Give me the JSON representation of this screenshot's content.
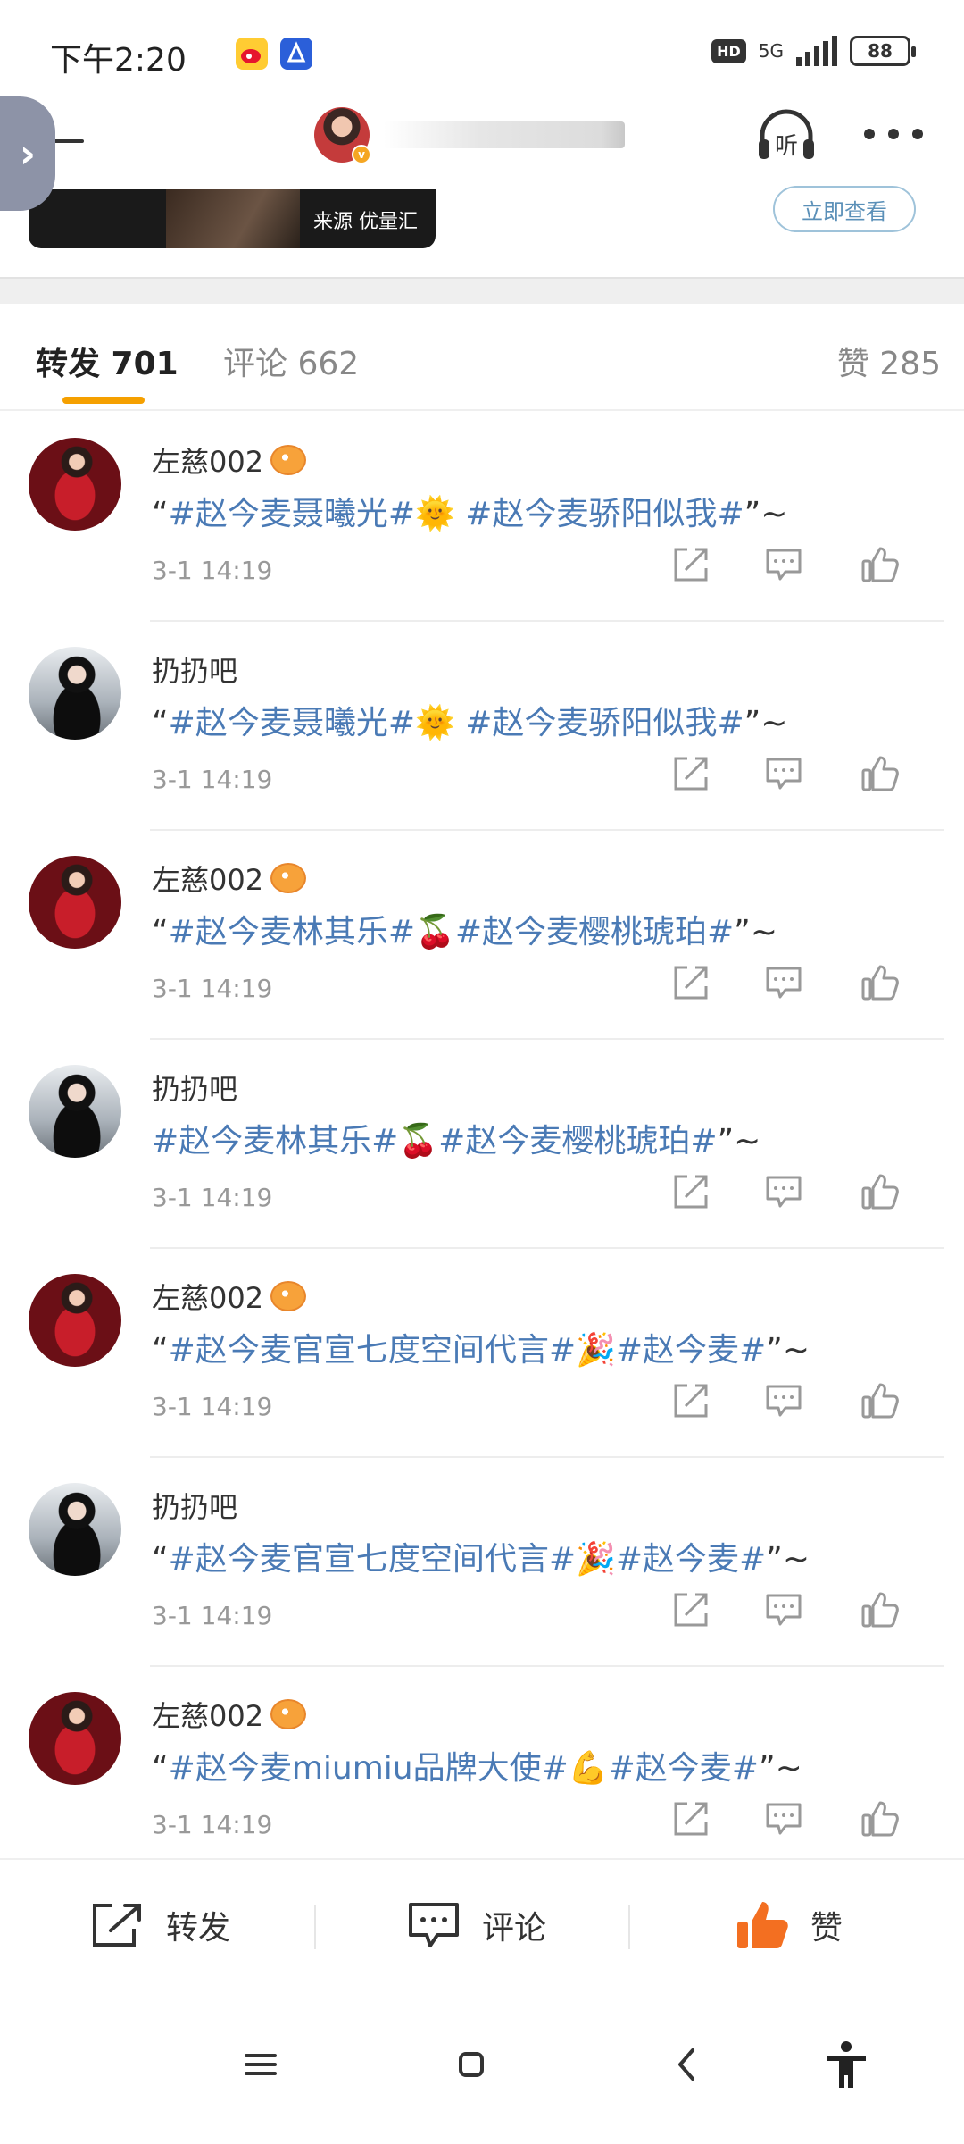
{
  "status_bar": {
    "time": "下午2:20",
    "network": "5G",
    "hd": "HD",
    "battery": "88"
  },
  "header": {
    "listen_label": "听"
  },
  "ad": {
    "source": "来源 优量汇",
    "cta": "立即查看"
  },
  "tabs": {
    "repost": "转发 701",
    "comment": "评论 662",
    "like": "赞 285"
  },
  "items": [
    {
      "user": "左慈002",
      "badge": true,
      "avatar": "red",
      "pre": "“",
      "t1": "#赵今麦聂曦光#",
      "emoji": "🌞",
      "sep": " ",
      "t2": "#赵今麦骄阳似我#",
      "post": "”~",
      "time": "3-1 14:19"
    },
    {
      "user": "扔扔吧",
      "badge": false,
      "avatar": "dark",
      "pre": "“",
      "t1": "#赵今麦聂曦光#",
      "emoji": "🌞",
      "sep": " ",
      "t2": "#赵今麦骄阳似我#",
      "post": "”~",
      "time": "3-1 14:19"
    },
    {
      "user": "左慈002",
      "badge": true,
      "avatar": "red",
      "pre": "“",
      "t1": "#赵今麦林其乐#",
      "emoji": "🍒",
      "sep": "",
      "t2": "#赵今麦樱桃琥珀#",
      "post": "”~",
      "time": "3-1 14:19"
    },
    {
      "user": "扔扔吧",
      "badge": false,
      "avatar": "dark",
      "pre": "",
      "t1": "#赵今麦林其乐#",
      "emoji": "🍒",
      "sep": "",
      "t2": "#赵今麦樱桃琥珀#",
      "post": "”~",
      "time": "3-1 14:19"
    },
    {
      "user": "左慈002",
      "badge": true,
      "avatar": "red",
      "pre": "“",
      "t1": "#赵今麦官宣七度空间代言#",
      "emoji": "🎉",
      "sep": "",
      "t2": "#赵今麦#",
      "post": "”~",
      "time": "3-1 14:19"
    },
    {
      "user": "扔扔吧",
      "badge": false,
      "avatar": "dark",
      "pre": "“",
      "t1": "#赵今麦官宣七度空间代言#",
      "emoji": "🎉",
      "sep": "",
      "t2": "#赵今麦#",
      "post": "”~",
      "time": "3-1 14:19"
    },
    {
      "user": "左慈002",
      "badge": true,
      "avatar": "red",
      "pre": "“",
      "t1": "#赵今麦miumiu品牌大使#",
      "emoji": "💪",
      "sep": "",
      "t2": "#赵今麦#",
      "post": "”~",
      "time": "3-1 14:19"
    }
  ],
  "bottom_bar": {
    "repost": "转发",
    "comment": "评论",
    "like": "赞"
  },
  "colors": {
    "topic": "#4a7ab5",
    "accent": "#f5a000",
    "like_active": "#f36f21"
  }
}
